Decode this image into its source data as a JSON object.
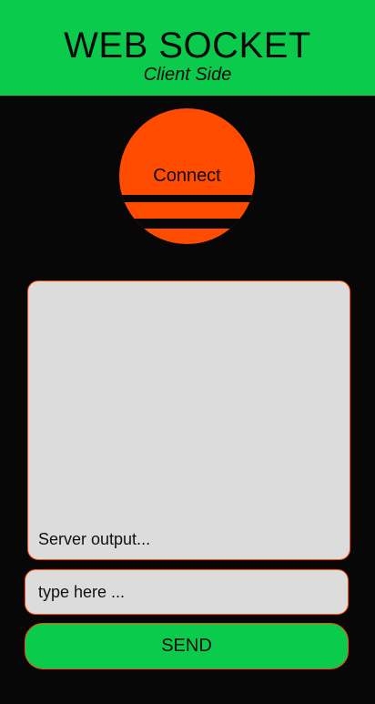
{
  "header": {
    "title": "WEB SOCKET",
    "subtitle": "Client Side"
  },
  "connect": {
    "label": "Connect"
  },
  "output": {
    "placeholder": "Server output..."
  },
  "input": {
    "placeholder": "type here ...",
    "value": ""
  },
  "send": {
    "label": "SEND"
  },
  "colors": {
    "accent_green": "#0bcb4c",
    "accent_orange": "#ff4c00",
    "background": "#070707",
    "field_gray": "#dcdcdc"
  }
}
